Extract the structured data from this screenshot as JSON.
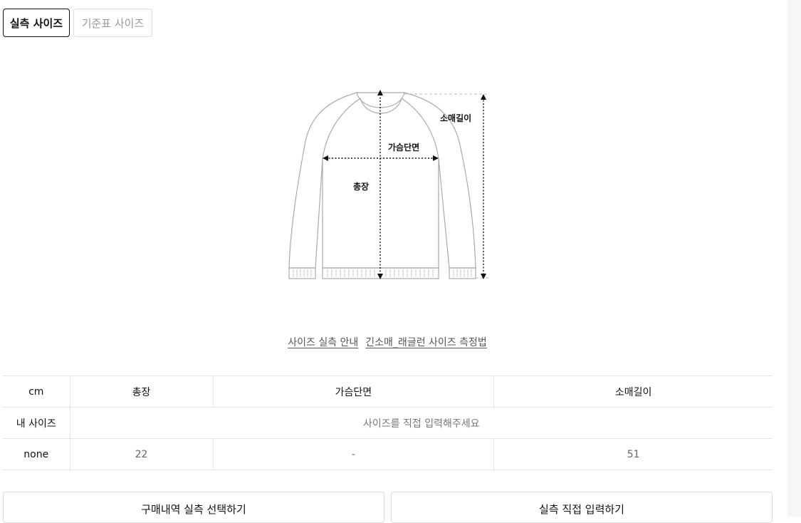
{
  "tabs": [
    {
      "label": "실측 사이즈",
      "active": true
    },
    {
      "label": "기준표 사이즈",
      "active": false
    }
  ],
  "figure": {
    "label_sleeve": "소매길이",
    "label_chest": "가슴단면",
    "label_length": "총장"
  },
  "links": {
    "guide": "사이즈 실측 안내",
    "method": "긴소매_래글런 사이즈 측정법"
  },
  "table": {
    "headers": [
      "cm",
      "총장",
      "가슴단면",
      "소매길이"
    ],
    "my_size_label": "내 사이즈",
    "my_size_hint": "사이즈를 직접 입력해주세요",
    "row": {
      "name": "none",
      "values": [
        "22",
        "-",
        "51"
      ]
    }
  },
  "buttons": {
    "history": "구매내역 실측 선택하기",
    "manual": "실측 직접 입력하기"
  },
  "colors": {
    "active_border": "#111111",
    "inactive_text": "#999999",
    "grid": "#e4e4e4"
  }
}
